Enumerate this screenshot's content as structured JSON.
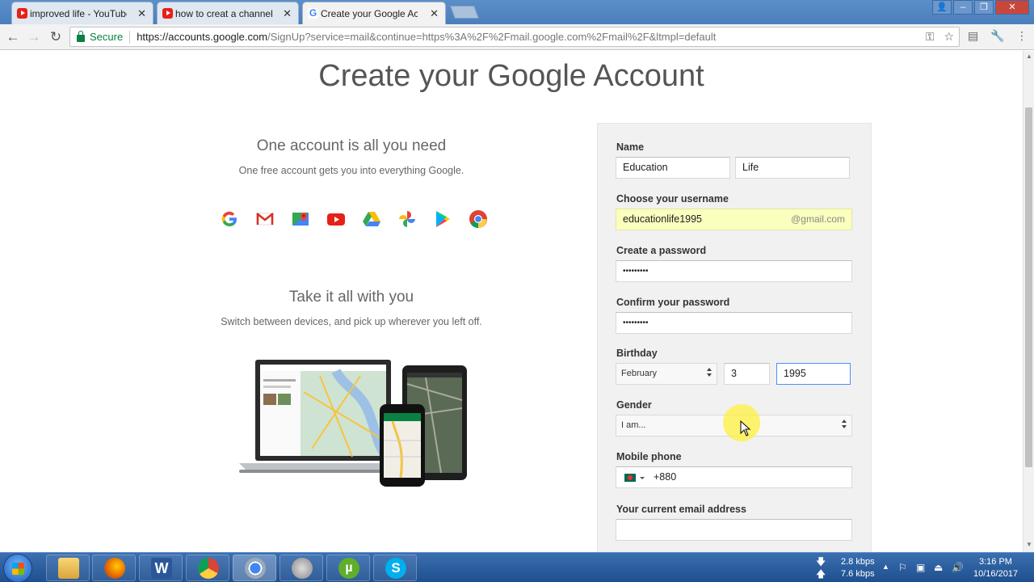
{
  "browser": {
    "tabs": [
      {
        "title": "improved life - YouTube",
        "favicon": "youtube-icon",
        "active": false
      },
      {
        "title": "how to creat a channel -",
        "favicon": "youtube-icon",
        "active": false
      },
      {
        "title": "Create your Google Acco",
        "favicon": "google-icon",
        "active": true
      }
    ],
    "secure_label": "Secure",
    "url_host": "https://accounts.google.com",
    "url_rest": "/SignUp?service=mail&continue=https%3A%2F%2Fmail.google.com%2Fmail%2F&ltmpl=default"
  },
  "page": {
    "title": "Create your Google Account",
    "promo1": {
      "heading": "One account is all you need",
      "text": "One free account gets you into everything Google."
    },
    "promo2": {
      "heading": "Take it all with you",
      "text": "Switch between devices, and pick up wherever you left off."
    },
    "product_icons": [
      "google-icon",
      "gmail-icon",
      "maps-icon",
      "youtube-icon",
      "drive-icon",
      "photos-icon",
      "play-icon",
      "chrome-icon"
    ]
  },
  "form": {
    "name_label": "Name",
    "first_name": "Education",
    "last_name": "Life",
    "username_label": "Choose your username",
    "username": "educationlife1995",
    "username_suffix": "@gmail.com",
    "password_label": "Create a password",
    "password": "•••••••••",
    "confirm_label": "Confirm your password",
    "confirm": "•••••••••",
    "birthday_label": "Birthday",
    "birth_month": "February",
    "birth_day": "3",
    "birth_year": "1995",
    "gender_label": "Gender",
    "gender_value": "I am...",
    "phone_label": "Mobile phone",
    "phone_code": "+880",
    "email_label": "Your current email address",
    "email": ""
  },
  "taskbar": {
    "net_down": "2.8 kbps",
    "net_up": "7.6 kbps",
    "time": "3:16 PM",
    "date": "10/16/2017"
  }
}
